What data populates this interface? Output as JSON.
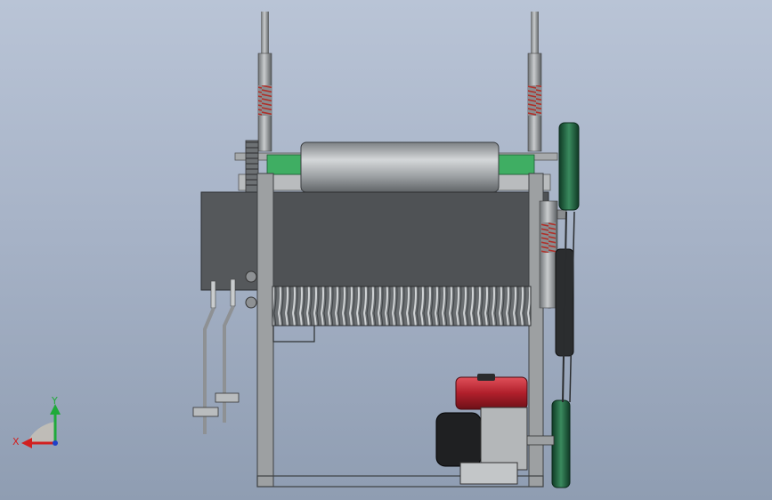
{
  "triad": {
    "x_label": "X",
    "y_label": "Y",
    "x_color": "#d22020",
    "y_color": "#1faa3a",
    "z_color": "#2040c8"
  },
  "colors": {
    "frame": "#9a9d9f",
    "panel": "#4d5053",
    "roller": "#9fa3a6",
    "engine_tank": "#b3202c",
    "engine_body": "#2a2b2d",
    "pulley": "#1f5a3c",
    "spring": "#b0302a",
    "green_bushing": "#3fae63"
  }
}
